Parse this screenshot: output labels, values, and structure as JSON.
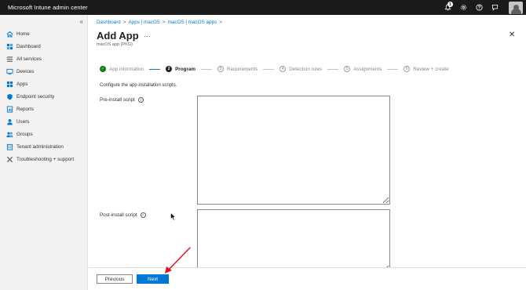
{
  "app": {
    "title": "Microsoft Intune admin center",
    "notification_count": "1"
  },
  "sidebar": {
    "collapse_glyph": "«",
    "items": [
      {
        "label": "Home",
        "icon": "home-icon"
      },
      {
        "label": "Dashboard",
        "icon": "dashboard-icon"
      },
      {
        "label": "All services",
        "icon": "all-services-icon"
      },
      {
        "label": "Devices",
        "icon": "devices-icon"
      },
      {
        "label": "Apps",
        "icon": "apps-icon"
      },
      {
        "label": "Endpoint security",
        "icon": "endpoint-security-icon"
      },
      {
        "label": "Reports",
        "icon": "reports-icon"
      },
      {
        "label": "Users",
        "icon": "users-icon"
      },
      {
        "label": "Groups",
        "icon": "groups-icon"
      },
      {
        "label": "Tenant administration",
        "icon": "tenant-admin-icon"
      },
      {
        "label": "Troubleshooting + support",
        "icon": "troubleshooting-icon"
      }
    ]
  },
  "breadcrumb": [
    "Dashboard",
    "Apps | macOS",
    "macOS | macOS apps"
  ],
  "page": {
    "title": "Add App",
    "subtitle": "macOS app (PKG)",
    "more": "···",
    "close": "✕"
  },
  "steps": [
    {
      "num": "✓",
      "label": "App information",
      "state": "done"
    },
    {
      "num": "2",
      "label": "Program",
      "state": "current"
    },
    {
      "num": "3",
      "label": "Requirements",
      "state": "pending"
    },
    {
      "num": "4",
      "label": "Detection rules",
      "state": "pending"
    },
    {
      "num": "5",
      "label": "Assignments",
      "state": "pending"
    },
    {
      "num": "6",
      "label": "Review + create",
      "state": "pending"
    }
  ],
  "form": {
    "instructions": "Configure the app installation scripts.",
    "pre_install_label": "Pre-install script",
    "pre_install_value": "",
    "post_install_label": "Post-install script",
    "post_install_value": "",
    "info_glyph": "i"
  },
  "footer": {
    "previous_label": "Previous",
    "next_label": "Next"
  },
  "colors": {
    "accent": "#0078d4",
    "topbar": "#1b1a19",
    "success": "#107c10",
    "annotation_arrow": "#e81123"
  }
}
